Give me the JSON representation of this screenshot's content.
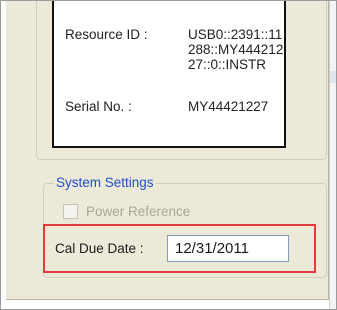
{
  "device_info": {
    "resource_id_label": "Resource ID :",
    "resource_id_value": "USB0::2391::11\n288::MY444212\n27::0::INSTR",
    "serial_label": "Serial No. :",
    "serial_value": "MY44421227"
  },
  "system_settings": {
    "title": "System Settings",
    "power_reference_label": "Power Reference",
    "power_reference_checked": false,
    "power_reference_enabled": false,
    "cal_due_label": "Cal Due Date :",
    "cal_due_value": "12/31/2011"
  },
  "colors": {
    "panel_background": "#ece9d8",
    "group_title": "#1f4fc9",
    "highlight": "#e23b3b",
    "input_border": "#7f9db9"
  }
}
